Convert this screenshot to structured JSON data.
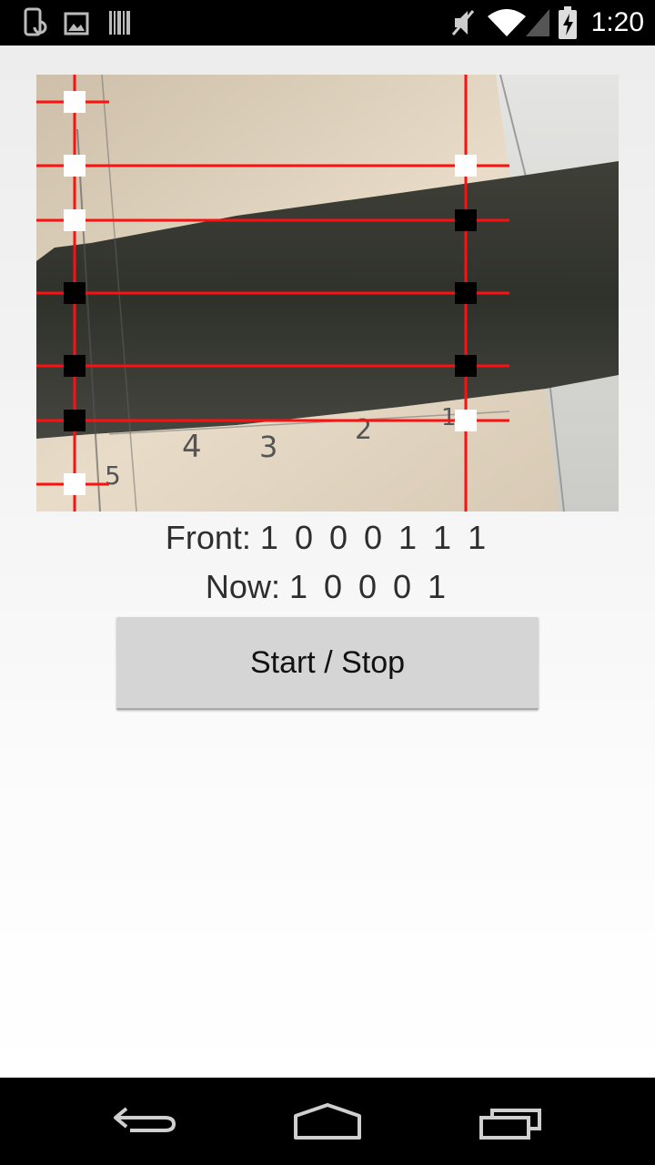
{
  "status_bar": {
    "time": "1:20",
    "icons": [
      "phone-sync-icon",
      "image-icon",
      "barcode-icon",
      "mute-icon",
      "wifi-icon",
      "signal-icon",
      "battery-charging-icon"
    ]
  },
  "camera": {
    "description_icon": "camera-preview",
    "scribbled_numbers": [
      "4",
      "3",
      "2",
      "1",
      "5"
    ],
    "left_column_markers": [
      "white",
      "white",
      "white",
      "black",
      "black",
      "black",
      "white"
    ],
    "right_column_markers": [
      "white",
      "black",
      "black",
      "black",
      "white"
    ]
  },
  "readouts": {
    "front_label": "Front:",
    "front_value": "1 0 0 0 1 1 1",
    "now_label": "Now:",
    "now_value": "1 0 0 0 1"
  },
  "controls": {
    "start_stop_label": "Start / Stop"
  },
  "nav": {
    "back": "back-icon",
    "home": "home-icon",
    "recents": "recents-icon"
  }
}
